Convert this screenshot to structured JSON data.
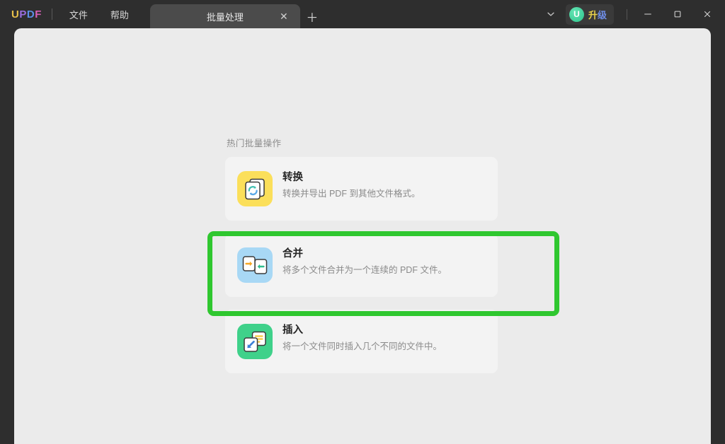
{
  "app": {
    "logo_letters": [
      "U",
      "P",
      "D",
      "F"
    ],
    "logo_colors": [
      "#e8c14a",
      "#9b6ee0",
      "#5b8fe8",
      "#d95fb8"
    ]
  },
  "titlebar": {
    "menu": [
      {
        "label": "文件",
        "name": "menu-item-file"
      },
      {
        "label": "帮助",
        "name": "menu-item-help"
      }
    ],
    "tabs": [
      {
        "label": "批量处理",
        "active": true,
        "close_glyph": "✕"
      }
    ],
    "new_tab_glyph": "＋",
    "chevron_glyph": "⌄",
    "upgrade": {
      "avatar_letter": "U",
      "label_part1": "升",
      "label_part2": "级",
      "accent_color": "#2ec58c"
    },
    "window_controls": {
      "minimize": "—",
      "maximize": "▢",
      "close": "✕"
    }
  },
  "main": {
    "section_title": "热门批量操作",
    "cards": [
      {
        "name": "card-convert",
        "title": "转换",
        "desc": "转换并导出 PDF 到其他文件格式。",
        "icon": "convert-icon",
        "icon_bg": "#fbdf5a",
        "highlighted": false
      },
      {
        "name": "card-merge",
        "title": "合并",
        "desc": "将多个文件合并为一个连续的 PDF 文件。",
        "icon": "merge-icon",
        "icon_bg": "#a8d8f5",
        "highlighted": true
      },
      {
        "name": "card-insert",
        "title": "插入",
        "desc": "将一个文件同时插入几个不同的文件中。",
        "icon": "insert-icon",
        "icon_bg": "#3fd18a",
        "highlighted": false
      }
    ],
    "highlight_color": "#2fc72f"
  },
  "colors": {
    "titlebar_bg": "#2e2e2e",
    "content_bg": "#ebebeb",
    "card_bg": "#f3f3f3",
    "tab_active_bg": "#4b4b4b"
  }
}
